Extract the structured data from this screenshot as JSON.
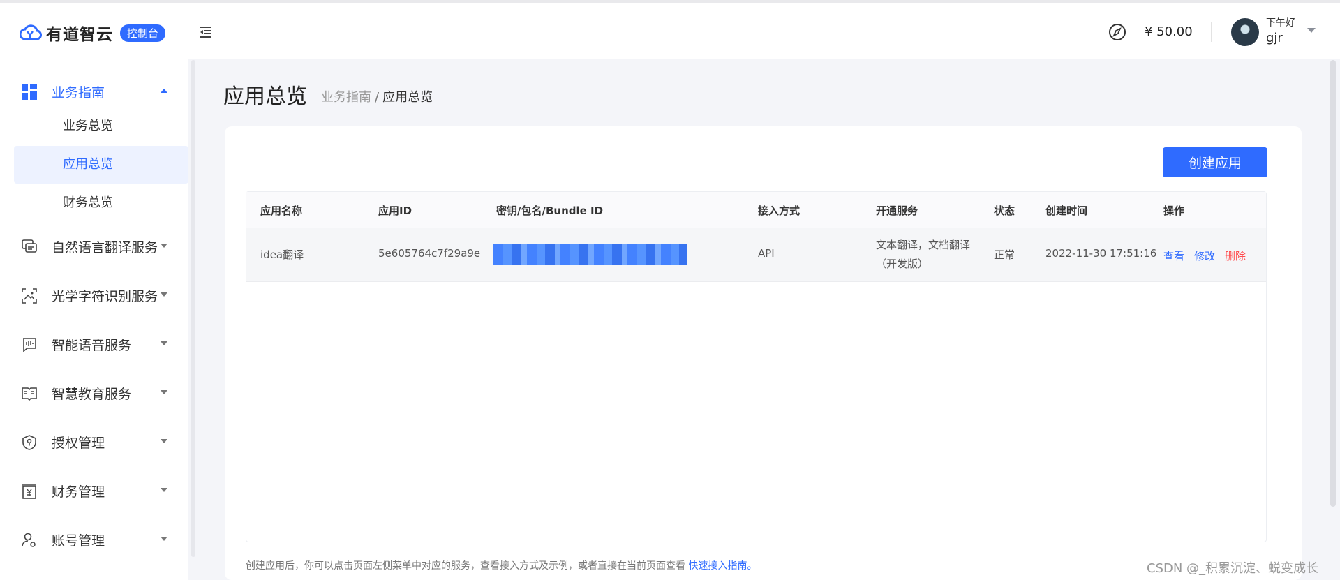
{
  "header": {
    "logo_text": "有道智云",
    "logo_badge": "控制台",
    "balance": "¥ 50.00",
    "greeting": "下午好",
    "username": "gjr"
  },
  "sidebar": {
    "groups": [
      {
        "label": "业务指南",
        "icon": "dashboard-grid-icon",
        "expanded": true,
        "children": [
          {
            "label": "业务总览",
            "selected": false
          },
          {
            "label": "应用总览",
            "selected": true
          },
          {
            "label": "财务总览",
            "selected": false
          }
        ]
      },
      {
        "label": "自然语言翻译服务",
        "icon": "chat-translate-icon",
        "expanded": false
      },
      {
        "label": "光学字符识别服务",
        "icon": "scan-image-icon",
        "expanded": false
      },
      {
        "label": "智能语音服务",
        "icon": "voice-wave-icon",
        "expanded": false
      },
      {
        "label": "智慧教育服务",
        "icon": "book-icon",
        "expanded": false
      },
      {
        "label": "授权管理",
        "icon": "shield-key-icon",
        "expanded": false
      },
      {
        "label": "财务管理",
        "icon": "yuan-box-icon",
        "expanded": false
      },
      {
        "label": "账号管理",
        "icon": "user-settings-icon",
        "expanded": false
      }
    ]
  },
  "main": {
    "title": "应用总览",
    "breadcrumb": {
      "parent": "业务指南",
      "separator": "/",
      "current": "应用总览"
    },
    "create_button": "创建应用",
    "table": {
      "columns": [
        "应用名称",
        "应用ID",
        "密钥/包名/Bundle ID",
        "接入方式",
        "开通服务",
        "状态",
        "创建时间",
        "操作"
      ],
      "rows": [
        {
          "name": "idea翻译",
          "app_id": "5e605764c7f29a9e",
          "secret": "",
          "access": "API",
          "services_line1": "文本翻译，文档翻译",
          "services_line2": "（开发版）",
          "status": "正常",
          "created": "2022-11-30 17:51:16",
          "ops": [
            "查看",
            "修改",
            "删除"
          ]
        }
      ]
    },
    "hint_text": "创建应用后，你可以点击页面左侧菜单中对应的服务，查看接入方式及示例，或者直接在当前页面查看 ",
    "hint_link": "快速接入指南。"
  },
  "watermark": "CSDN @_积累沉淀、蜕变成长",
  "colors": {
    "accent": "#2f6bff",
    "danger": "#ff4d4f"
  }
}
